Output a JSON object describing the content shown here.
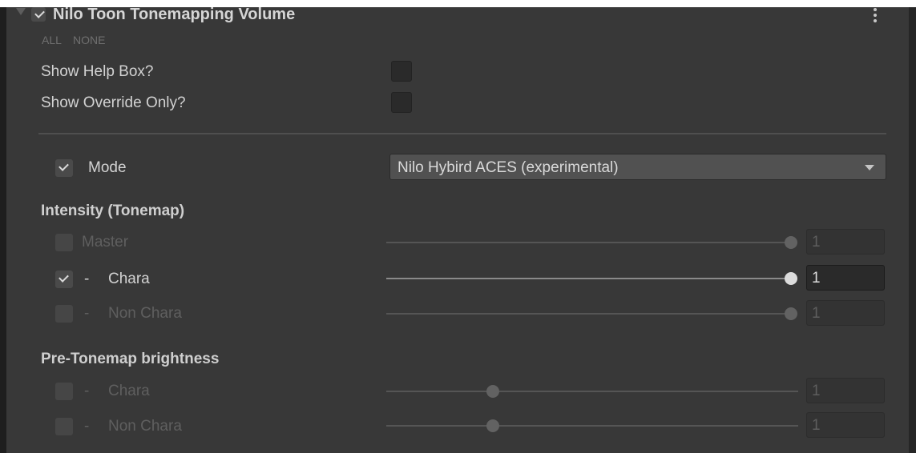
{
  "header": {
    "title": "Nilo Toon Tonemapping Volume",
    "enabled": true
  },
  "toggles": {
    "all_label": "ALL",
    "none_label": "NONE"
  },
  "options": [
    {
      "label": "Show Help Box?",
      "checked": false
    },
    {
      "label": "Show Override Only?",
      "checked": false
    }
  ],
  "mode": {
    "label": "Mode",
    "override": true,
    "value": "Nilo Hybird ACES (experimental)"
  },
  "intensity": {
    "title": "Intensity (Tonemap)",
    "rows": [
      {
        "prefix": "",
        "label": "Master",
        "override": false,
        "value": "1",
        "level": 1.0
      },
      {
        "prefix": "-",
        "label": "Chara",
        "override": true,
        "value": "1",
        "level": 1.0
      },
      {
        "prefix": "-",
        "label": "Non Chara",
        "override": false,
        "value": "1",
        "level": 1.0
      }
    ]
  },
  "brightness": {
    "title": "Pre-Tonemap brightness",
    "rows": [
      {
        "prefix": "-",
        "label": "Chara",
        "override": false,
        "value": "1",
        "level": 0.25
      },
      {
        "prefix": "-",
        "label": "Non Chara",
        "override": false,
        "value": "1",
        "level": 0.25
      }
    ]
  },
  "colors": {
    "panel_bg": "#383838",
    "field_bg": "#2a2a2a",
    "knob_active": "#dcdcdc",
    "text_dim": "#5f5f5f"
  }
}
